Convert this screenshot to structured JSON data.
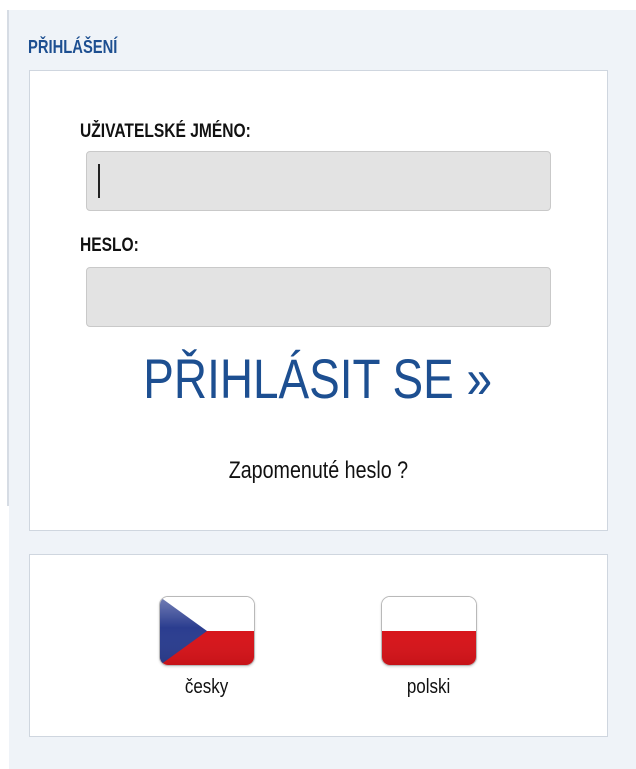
{
  "login": {
    "section_title": "PŘIHLÁŠENÍ",
    "username_label": "UŽIVATELSKÉ JMÉNO:",
    "username_value": "",
    "password_label": "HESLO:",
    "password_value": "",
    "submit_label": "PŘIHLÁSIT SE »",
    "forgot_label": "Zapomenuté heslo ?"
  },
  "languages": [
    {
      "label": "česky",
      "icon": "czech-flag-icon"
    },
    {
      "label": "polski",
      "icon": "polish-flag-icon"
    }
  ],
  "colors": {
    "accent": "#1d4f91",
    "page_background": "#eff3f8",
    "input_background": "#e3e3e3",
    "czech_blue": "#2b3d8f",
    "flag_red": "#d7141a"
  }
}
